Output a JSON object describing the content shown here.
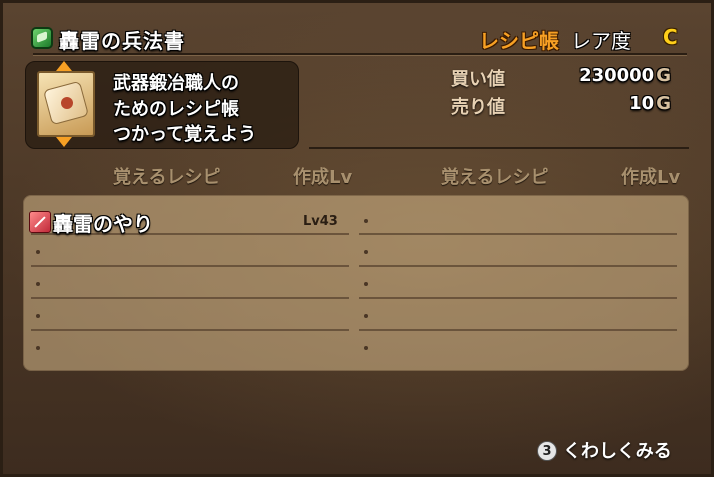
{
  "header": {
    "title": "轟雷の兵法書",
    "recipe_book_label": "レシピ帳",
    "rarity_label": "レア度",
    "rarity_value": "C"
  },
  "description": {
    "lines": [
      "武器鍛冶職人の",
      "ためのレシピ帳",
      "つかって覚えよう"
    ]
  },
  "prices": {
    "buy_label": "買い値",
    "buy_value": "230000",
    "sell_label": "売り値",
    "sell_value": "10",
    "currency": "G"
  },
  "table": {
    "col_recipe_left": "覚えるレシピ",
    "col_lv_left": "作成Lv",
    "col_recipe_right": "覚えるレシピ",
    "col_lv_right": "作成Lv",
    "recipes": [
      {
        "name": "轟雷のやり",
        "level": "Lv43",
        "icon": "spear-icon"
      }
    ]
  },
  "footer": {
    "button_number": "3",
    "label": "くわしくみる"
  },
  "colors": {
    "recipe_book_label": "#f7a024",
    "rarity_value": "#ffcf1a",
    "table_bg": "#d7b98c"
  }
}
